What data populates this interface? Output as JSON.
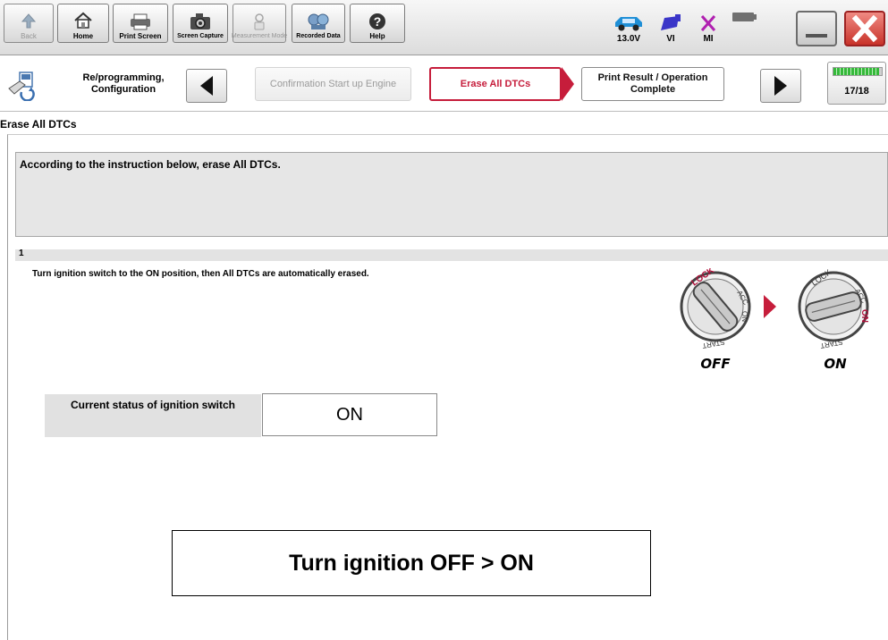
{
  "toolbar": {
    "buttons": [
      {
        "label": "Back",
        "icon": "back-arrow-icon"
      },
      {
        "label": "Home",
        "icon": "home-icon"
      },
      {
        "label": "Print Screen",
        "icon": "printer-icon"
      },
      {
        "label": "Screen Capture",
        "icon": "camera-icon"
      },
      {
        "label": "Measurement Mode",
        "icon": "measurement-icon"
      },
      {
        "label": "Recorded Data",
        "icon": "recorded-data-icon"
      },
      {
        "label": "Help",
        "icon": "help-icon"
      }
    ],
    "battery_voltage": "13.0V",
    "vi_label": "VI",
    "mi_label": "MI"
  },
  "breadcrumb": {
    "title": "Re/programming, Configuration",
    "steps": {
      "previous": "Confirmation Start up Engine",
      "current": "Erase All DTCs",
      "next": "Print Result / Operation Complete"
    },
    "progress_text": "17/18",
    "progress_fraction": 0.944
  },
  "content": {
    "section_title": "Erase All DTCs",
    "instruction": "According to the instruction below, erase All DTCs.",
    "step_number": "1",
    "step_text": "Turn ignition switch to the ON position, then All DTCs are automatically erased.",
    "ignition_diagram": {
      "lock": "LOCK",
      "acc": "ACC",
      "on": "ON",
      "start": "START",
      "off_caption": "OFF",
      "on_caption": "ON"
    },
    "status_label": "Current status of ignition switch",
    "status_value": "ON",
    "callout": "Turn ignition OFF > ON"
  },
  "colors": {
    "accent_red": "#c61d3b",
    "progress_green": "#35b93a",
    "vehicle_blue": "#1f8fd6",
    "vi_purple": "#3a35c8",
    "mi_purple": "#b020b0",
    "close_red": "#c8332a"
  }
}
